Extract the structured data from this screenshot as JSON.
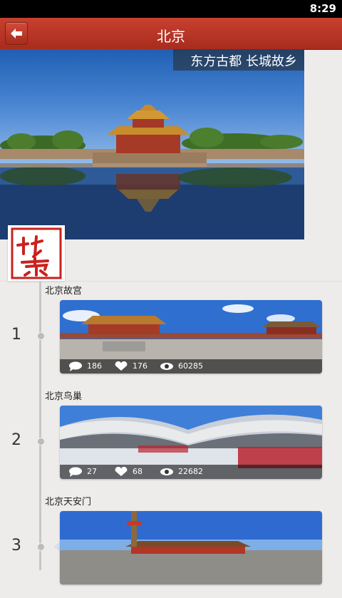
{
  "status_bar": {
    "time": "8:29"
  },
  "header": {
    "title": "北京",
    "back_icon": "back-arrow-icon"
  },
  "hero": {
    "tagline": "东方古都 长城故乡"
  },
  "entries": [
    {
      "index": "1",
      "title": "北京故宫",
      "comments": "186",
      "likes": "176",
      "views": "60285"
    },
    {
      "index": "2",
      "title": "北京鸟巢",
      "comments": "27",
      "likes": "68",
      "views": "22682"
    },
    {
      "index": "3",
      "title": "北京天安门"
    }
  ],
  "colors": {
    "accent": "#b8351f",
    "timeline": "#c9c7c5",
    "background": "#eeecea"
  }
}
